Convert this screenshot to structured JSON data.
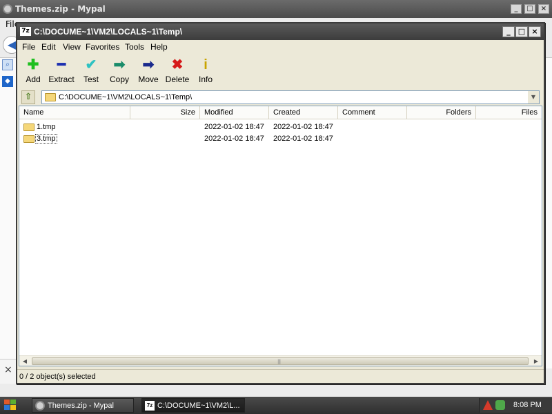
{
  "background_window": {
    "title": "Themes.zip - Mypal",
    "menu_fragment": "File",
    "buttons": [
      "_",
      "□",
      "×"
    ],
    "close_x": "×"
  },
  "window": {
    "title": "C:\\DOCUME~1\\VM2\\LOCALS~1\\Temp\\",
    "logo": "7z",
    "controls": {
      "minimize": "_",
      "maximize": "□",
      "close": "×"
    }
  },
  "menu": [
    "File",
    "Edit",
    "View",
    "Favorites",
    "Tools",
    "Help"
  ],
  "toolbar": [
    {
      "label": "Add",
      "icon": "plus-icon",
      "glyph": "✚",
      "color": "#1fbf1f"
    },
    {
      "label": "Extract",
      "icon": "minus-icon",
      "glyph": "━",
      "color": "#1c2fb0"
    },
    {
      "label": "Test",
      "icon": "check-icon",
      "glyph": "✔",
      "color": "#2ec2c2"
    },
    {
      "label": "Copy",
      "icon": "copy-arrow-icon",
      "glyph": "➡",
      "color": "#1a8c6a"
    },
    {
      "label": "Move",
      "icon": "move-arrow-icon",
      "glyph": "➡",
      "color": "#1a2a8c"
    },
    {
      "label": "Delete",
      "icon": "delete-x-icon",
      "glyph": "✖",
      "color": "#d61a1a"
    },
    {
      "label": "Info",
      "icon": "info-icon",
      "glyph": "i",
      "color": "#c9a400"
    }
  ],
  "address": {
    "path": "C:\\DOCUME~1\\VM2\\LOCALS~1\\Temp\\",
    "up_glyph": "⇧",
    "dropdown_glyph": "▼"
  },
  "columns": [
    "Name",
    "Size",
    "Modified",
    "Created",
    "Comment",
    "Folders",
    "Files"
  ],
  "rows": [
    {
      "name": "1.tmp",
      "modified": "2022-01-02 18:47",
      "created": "2022-01-02 18:47"
    },
    {
      "name": "3.tmp",
      "modified": "2022-01-02 18:47",
      "created": "2022-01-02 18:47"
    }
  ],
  "scrollbar": {
    "left_arrow": "◀",
    "right_arrow": "▶",
    "grip": "|||"
  },
  "status": "0 / 2 object(s) selected",
  "taskbar": {
    "tasks": [
      {
        "label": "Themes.zip - Mypal"
      },
      {
        "label": "C:\\DOCUME~1\\VM2\\L..."
      }
    ],
    "task2_logo": "7z",
    "clock": "8:08 PM"
  }
}
